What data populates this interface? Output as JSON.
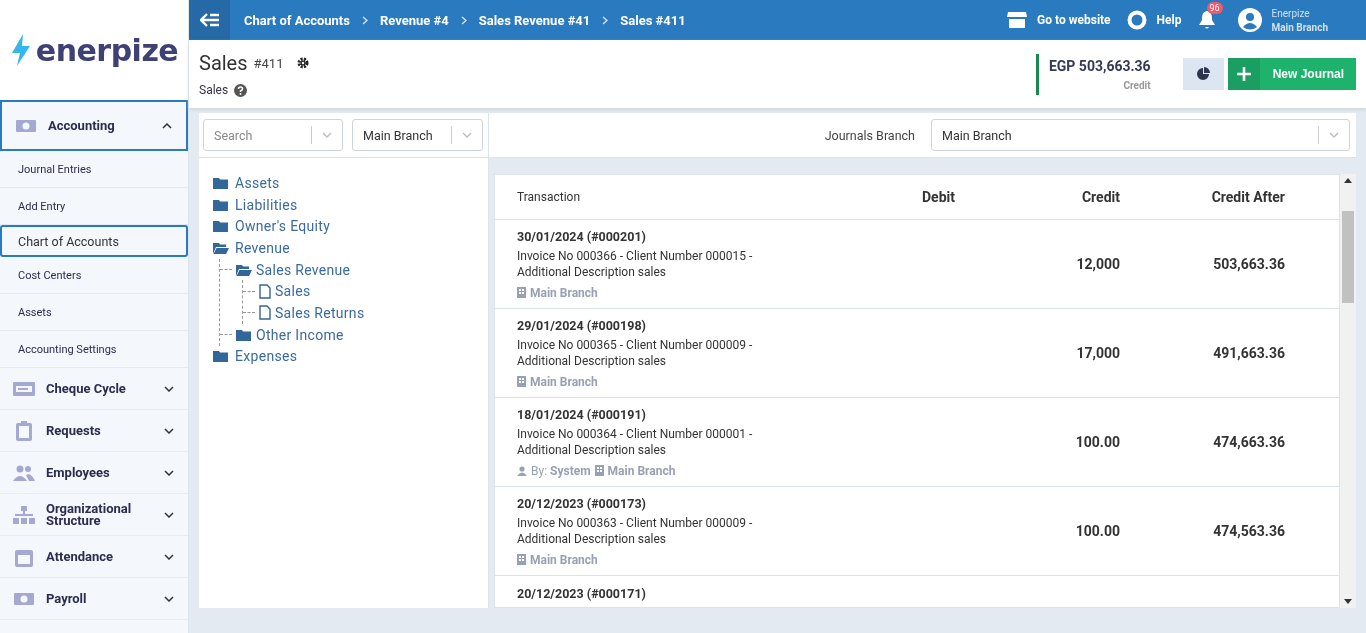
{
  "logo": {
    "text": "enerpize"
  },
  "breadcrumbs": [
    "Chart of Accounts",
    "Revenue #4",
    "Sales Revenue #41",
    "Sales #411"
  ],
  "topbar": {
    "website": "Go to website",
    "help": "Help",
    "notifications": "96",
    "user": "Enerpize",
    "branch": "Main Branch"
  },
  "sidebar": {
    "items": [
      {
        "label": "Accounting",
        "expanded": true,
        "children": [
          {
            "label": "Journal Entries",
            "selected": false
          },
          {
            "label": "Add Entry",
            "selected": false
          },
          {
            "label": "Chart of Accounts",
            "selected": true
          },
          {
            "label": "Cost Centers",
            "selected": false
          },
          {
            "label": "Assets",
            "selected": false
          },
          {
            "label": "Accounting Settings",
            "selected": false
          }
        ]
      },
      {
        "label": "Cheque Cycle",
        "expanded": false
      },
      {
        "label": "Requests",
        "expanded": false
      },
      {
        "label": "Employees",
        "expanded": false
      },
      {
        "label": "Organizational Structure",
        "expanded": false
      },
      {
        "label": "Attendance",
        "expanded": false
      },
      {
        "label": "Payroll",
        "expanded": false
      }
    ]
  },
  "header": {
    "title": "Sales",
    "code": "#411",
    "subtitle": "Sales",
    "amount": "EGP 503,663.36",
    "amount_label": "Credit",
    "new_button": "New Journal"
  },
  "filters": {
    "search_placeholder": "Search",
    "branch": "Main Branch",
    "journals_branch_label": "Journals Branch",
    "journals_branch": "Main Branch"
  },
  "tree": [
    {
      "label": "Assets",
      "kind": "folder",
      "expanded": false
    },
    {
      "label": "Liabilities",
      "kind": "folder",
      "expanded": false
    },
    {
      "label": "Owner's Equity",
      "kind": "folder",
      "expanded": false
    },
    {
      "label": "Revenue",
      "kind": "folder",
      "expanded": true,
      "children": [
        {
          "label": "Sales Revenue",
          "kind": "folder",
          "expanded": true,
          "children": [
            {
              "label": "Sales",
              "kind": "file"
            },
            {
              "label": "Sales Returns",
              "kind": "file"
            }
          ]
        },
        {
          "label": "Other Income",
          "kind": "folder",
          "expanded": false
        }
      ]
    },
    {
      "label": "Expenses",
      "kind": "folder",
      "expanded": false
    }
  ],
  "table": {
    "columns": [
      "Transaction",
      "Debit",
      "Credit",
      "Credit After"
    ],
    "rows": [
      {
        "title": "30/01/2024 (#000201)",
        "description": "Invoice No 000366 - Client Number 000015 - Additional Description sales",
        "meta": [
          {
            "kind": "branch",
            "value": "Main Branch"
          }
        ],
        "credit": "12,000",
        "credit_after": "503,663.36"
      },
      {
        "title": "29/01/2024 (#000198)",
        "description": "Invoice No 000365 - Client Number 000009 - Additional Description sales",
        "meta": [
          {
            "kind": "branch",
            "value": "Main Branch"
          }
        ],
        "credit": "17,000",
        "credit_after": "491,663.36"
      },
      {
        "title": "18/01/2024 (#000191)",
        "description": "Invoice No 000364 - Client Number 000001 - Additional Description sales",
        "meta": [
          {
            "kind": "user",
            "label": "By:",
            "value": "System"
          },
          {
            "kind": "branch",
            "value": "Main Branch"
          }
        ],
        "credit": "100.00",
        "credit_after": "474,663.36"
      },
      {
        "title": "20/12/2023 (#000173)",
        "description": "Invoice No 000363 - Client Number 000009 - Additional Description sales",
        "meta": [
          {
            "kind": "branch",
            "value": "Main Branch"
          }
        ],
        "credit": "100.00",
        "credit_after": "474,563.36"
      },
      {
        "title": "20/12/2023 (#000171)"
      }
    ]
  }
}
